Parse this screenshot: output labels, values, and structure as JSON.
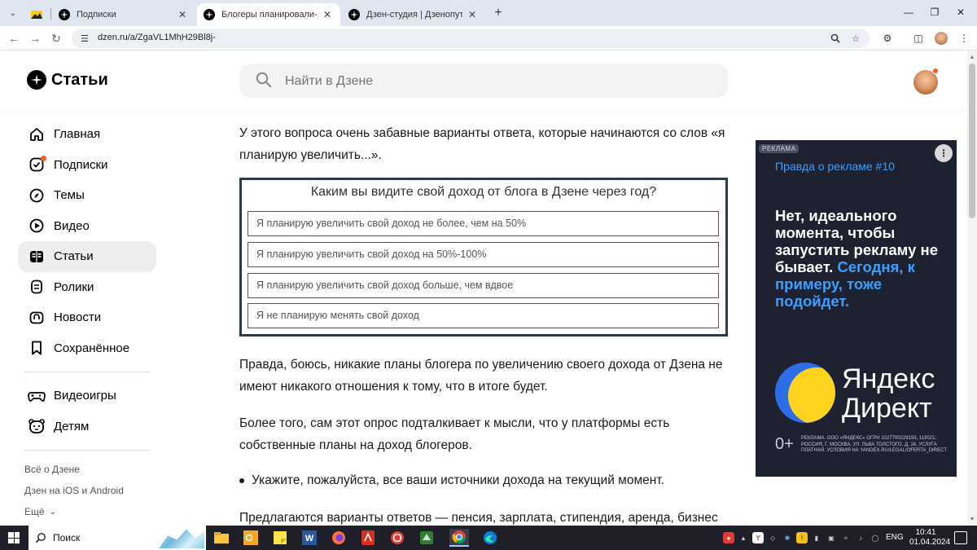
{
  "browser": {
    "tabs": [
      {
        "title": "",
        "active": false
      },
      {
        "title": "Подписки",
        "active": false
      },
      {
        "title": "Блогеры планировали-планир",
        "active": true
      },
      {
        "title": "Дзен-студия | Дзенопуть и его",
        "active": false
      }
    ],
    "url": "dzen.ru/a/ZgaVL1MhH29Bl8j-"
  },
  "header": {
    "logo": "Статьи",
    "search_placeholder": "Найти в Дзене"
  },
  "sidebar": {
    "items": [
      {
        "label": "Главная",
        "icon": "home-icon"
      },
      {
        "label": "Подписки",
        "icon": "subscriptions-icon"
      },
      {
        "label": "Темы",
        "icon": "compass-icon"
      },
      {
        "label": "Видео",
        "icon": "play-icon"
      },
      {
        "label": "Статьи",
        "icon": "articles-icon"
      },
      {
        "label": "Ролики",
        "icon": "shorts-icon"
      },
      {
        "label": "Новости",
        "icon": "news-icon"
      },
      {
        "label": "Сохранённое",
        "icon": "bookmark-icon"
      }
    ],
    "items2": [
      {
        "label": "Видеоигры",
        "icon": "gamepad-icon"
      },
      {
        "label": "Детям",
        "icon": "kids-icon"
      }
    ],
    "footer": {
      "about": "Всё о Дзене",
      "apps": "Дзен на iOS и Android",
      "more": "Ещё"
    }
  },
  "article": {
    "p1": "У этого вопроса очень забавные варианты ответа, которые начинаются со слов «я планирую увеличить...».",
    "poll": {
      "question": "Каким вы видите свой доход от блога в Дзене через год?",
      "options": [
        "Я планирую увеличить свой доход не более, чем на 50%",
        "Я планирую увеличить свой доход на 50%-100%",
        "Я планирую увеличить свой доход больше, чем вдвое",
        "Я не планирую менять свой доход"
      ]
    },
    "p2": "Правда, боюсь, никакие планы блогера по увеличению своего дохода от Дзена не имеют никакого отношения к тому, что в итоге будет.",
    "p3": "Более того, сам этот опрос подталкивает к мысли, что у платформы есть собственные планы на доход блогеров.",
    "li1": "Укажите, пожалуйста, все ваши источники дохода на текущий момент.",
    "p4": "Предлагаются варианты ответов — пенсия, зарплата, стипендия, аренда, бизнес"
  },
  "ad": {
    "badge": "РЕКЛАМА",
    "top": "Правда о рекламе #10",
    "headline_white": "Нет, идеального момента, чтобы запустить рекламу не бывает.",
    "headline_blue": "Сегодня, к примеру, тоже подойдет.",
    "brand_line1": "Яндекс",
    "brand_line2": "Директ",
    "age": "0+",
    "fine_print": "РЕКЛАМА. ООО «ЯНДЕКС» ОГРН 1027700229193, 119021, РОССИЯ, Г. МОСКВА, УЛ. ЛЬВА ТОЛСТОГО, Д. 16, УСЛУГА ПЛАТНАЯ. УСЛОВИЯ НА YANDEX.RU/LEGAL/OFERTA_DIRECT"
  },
  "taskbar": {
    "search": "Поиск",
    "lang": "ENG",
    "time": "10:41",
    "date": "01.04.2024"
  },
  "colors": {
    "notification": "#ff5a1f",
    "ad_bg": "#1e2130",
    "ad_accent": "#3aa0ff",
    "poll_border": "#2e3a50"
  }
}
